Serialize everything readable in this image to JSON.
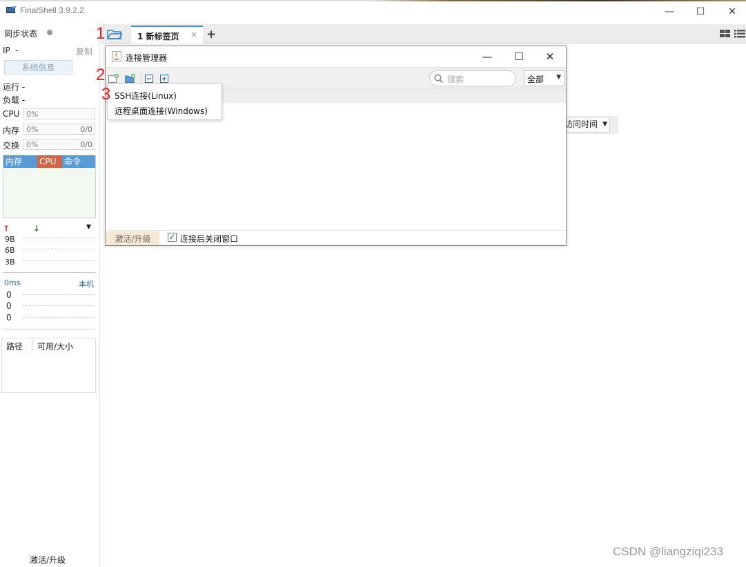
{
  "window": {
    "title": "FinalShell 3.9.2.2",
    "minimize_glyph": "—",
    "maximize_glyph": "☐",
    "close_glyph": "✕"
  },
  "sidebar": {
    "sync_status_label": "同步状态",
    "ip_label": "IP",
    "ip_value": "-",
    "copy_label": "复制",
    "sysinfo_button": "系统信息",
    "uptime_label": "运行 -",
    "load_label": "负载 -",
    "cpu_label": "CPU",
    "cpu_value": "0%",
    "mem_label": "内存",
    "mem_value": "0%",
    "mem_right": "0/0",
    "swap_label": "交换",
    "swap_value": "0%",
    "swap_right": "0/0",
    "proc_tabs": [
      "内存",
      "CPU",
      "命令"
    ],
    "net_labels": [
      "9B",
      "6B",
      "3B"
    ],
    "latency_label": "0ms",
    "latency_target": "本机",
    "latency_values": [
      "0",
      "0",
      "0"
    ],
    "disk_headers": [
      "路径",
      "可用/大小"
    ],
    "activate_label": "激活/升级"
  },
  "tabbar": {
    "tabs": [
      {
        "label": "1 新标签页"
      }
    ],
    "close_glyph": "×",
    "add_glyph": "+"
  },
  "background": {
    "sort_dropdown": "访问时间"
  },
  "dialog": {
    "title": "连接管理器",
    "search_placeholder": "搜索",
    "filter_value": "全部",
    "activate_label": "激活/升级",
    "close_after_connect_label": "连接后关闭窗口",
    "close_after_connect_checked": true
  },
  "popup_menu": {
    "items": [
      "SSH连接(Linux)",
      "远程桌面连接(Windows)"
    ]
  },
  "annotations": [
    "1",
    "2",
    "3"
  ],
  "watermark": "CSDN @liangziqi233",
  "colors": {
    "accent_blue": "#3c8fd8",
    "proc_header": "#5b9bd5",
    "cpu_tab": "#d0654a",
    "annotation_red": "#e02020",
    "activate_bg": "#f8e7d3"
  }
}
